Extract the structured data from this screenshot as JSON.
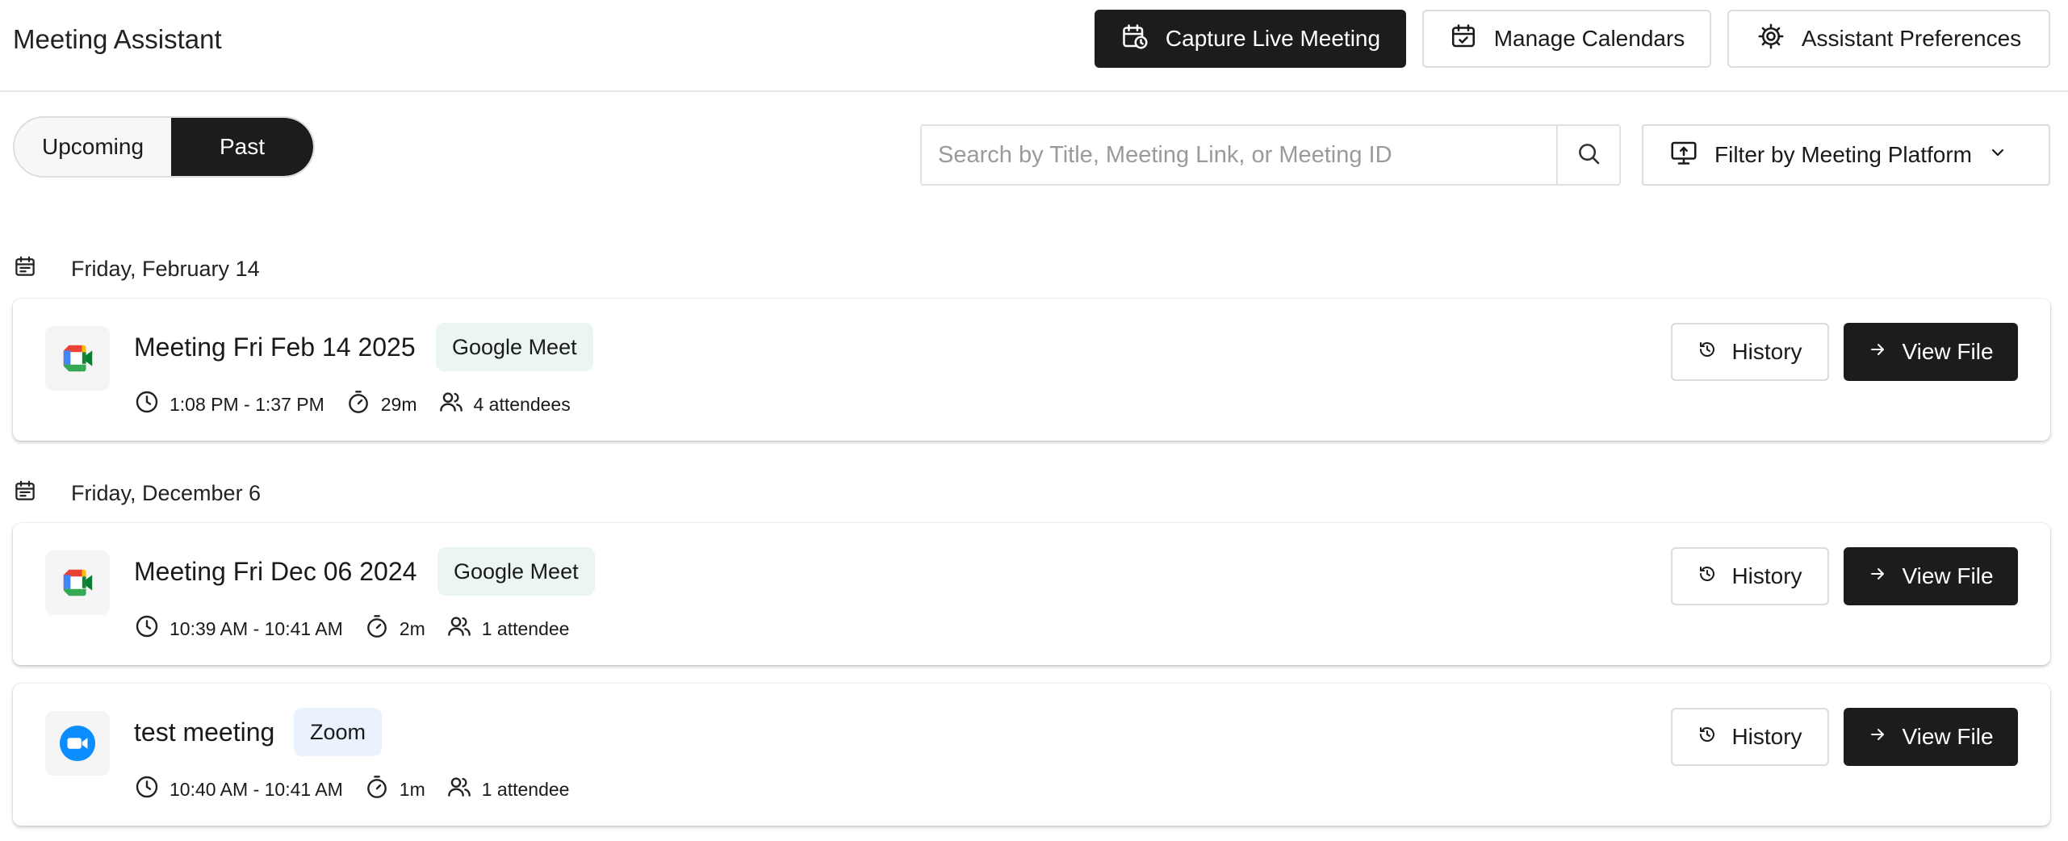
{
  "header": {
    "title": "Meeting Assistant",
    "capture_label": "Capture Live Meeting",
    "calendars_label": "Manage Calendars",
    "preferences_label": "Assistant Preferences"
  },
  "tabs": {
    "upcoming": "Upcoming",
    "past": "Past",
    "active": "Past"
  },
  "search": {
    "placeholder": "Search by Title, Meeting Link, or Meeting ID",
    "value": ""
  },
  "filter": {
    "label": "Filter by Meeting Platform"
  },
  "groups": [
    {
      "date": "Friday, February 14",
      "meetings": [
        {
          "title": "Meeting Fri Feb 14 2025",
          "platform": "Google Meet",
          "time": "1:08 PM - 1:37 PM",
          "duration": "29m",
          "attendees": "4 attendees",
          "history_label": "History",
          "view_label": "View File",
          "icon": "google-meet-icon"
        }
      ]
    },
    {
      "date": "Friday, December 6",
      "meetings": [
        {
          "title": "Meeting Fri Dec 06 2024",
          "platform": "Google Meet",
          "time": "10:39 AM - 10:41 AM",
          "duration": "2m",
          "attendees": "1 attendee",
          "history_label": "History",
          "view_label": "View File",
          "icon": "google-meet-icon"
        },
        {
          "title": "test meeting",
          "platform": "Zoom",
          "time": "10:40 AM - 10:41 AM",
          "duration": "1m",
          "attendees": "1 attendee",
          "history_label": "History",
          "view_label": "View File",
          "icon": "zoom-icon"
        }
      ]
    }
  ],
  "colors": {
    "dark_button": "#1c1c1c",
    "meet_badge": "#eaf6ef",
    "zoom_badge": "#eaf2fd",
    "zoom_blue": "#0b8cff"
  }
}
